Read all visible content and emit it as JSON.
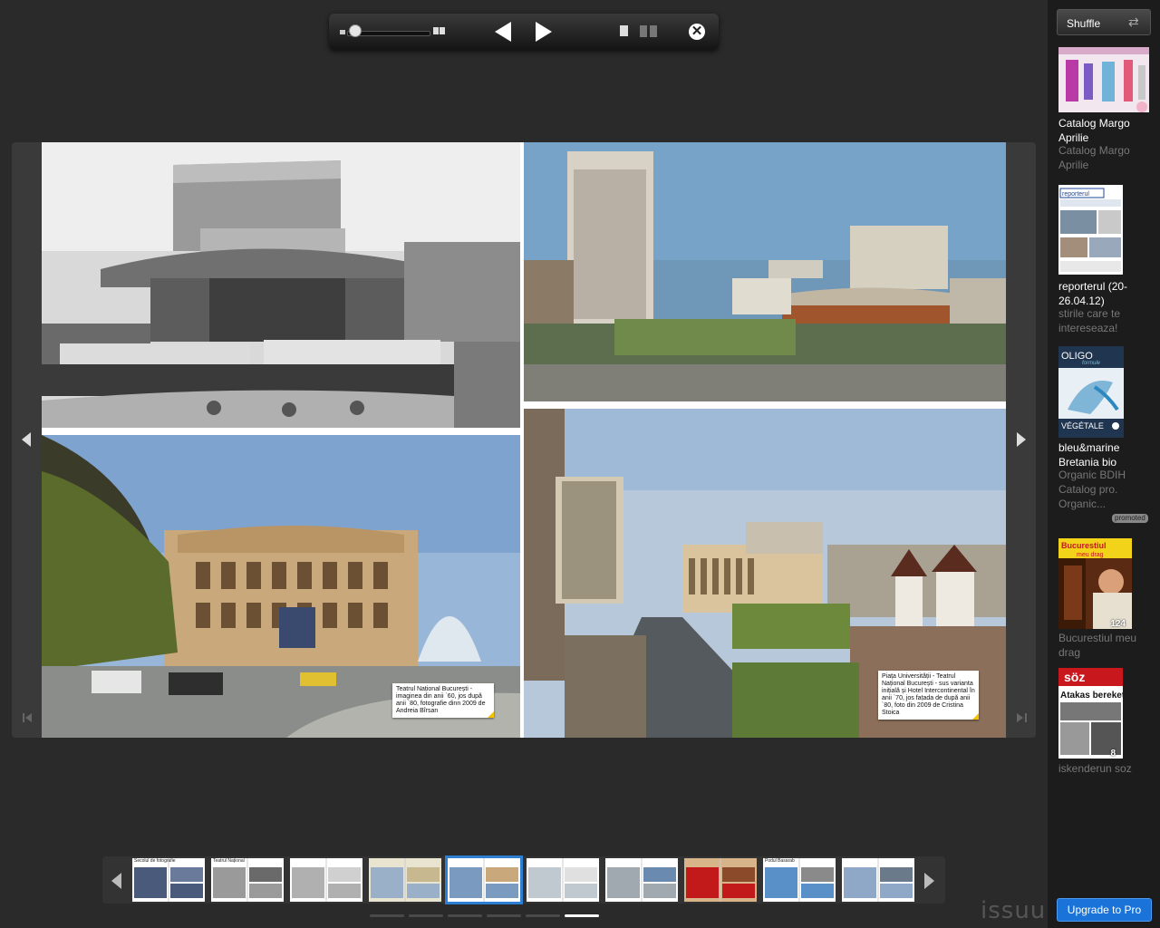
{
  "toolbar": {
    "icons": [
      "zoom-slider",
      "zoom-in-icon",
      "previous-page-icon",
      "next-page-icon",
      "single-page-view-icon",
      "double-page-view-icon",
      "close-icon"
    ],
    "zoom_level": 0.05
  },
  "spread": {
    "captions": {
      "left": "Teatrul Național București - imaginea din anii `60, jos după anii `80, fotografie dinn 2009 de Andreia Bîrsan",
      "right": "Piața Universității - Teatrul Național București - sus varianta inițială și Hotel Intercontinental în anii `70, jos fațada de după anii `80, foto din 2009 de Cristina Stoica"
    }
  },
  "thumbnails": {
    "pages": [
      "Secolul de fotografie",
      "Teatrul Național",
      "",
      "",
      "",
      "",
      "",
      "",
      "Podul Basarab",
      ""
    ],
    "active_index": 4,
    "pager_count": 6,
    "pager_active": 5
  },
  "brand": "issuu",
  "sidebar": {
    "shuffle_label": "Shuffle",
    "docs": [
      {
        "title": "Catalog Margo Aprilie",
        "desc": "Catalog Margo Aprilie",
        "count": ""
      },
      {
        "title": "reporterul (20-26.04.12)",
        "desc": "stirile care te intereseaza!",
        "count": ""
      },
      {
        "title": "bleu&marine Bretania bio",
        "desc": "Organic BDIH Catalog  pro. Organic...",
        "count": "",
        "cover_text": [
          "OLIGO",
          "formule",
          "VÉGÉTALE"
        ]
      },
      {
        "title": "",
        "desc": "Bucurestiul meu drag",
        "count": "124",
        "cover_text": [
          "Bucurestiul",
          "meu drag"
        ]
      },
      {
        "title": "",
        "desc": "iskenderun soz",
        "count": "8",
        "cover_text": [
          "söz",
          "Atakas bereketi!"
        ]
      }
    ],
    "promoted_label": "promoted",
    "upgrade_label": "Upgrade to Pro",
    "reporter_masthead": "reporterul"
  },
  "colors": {
    "background": "#2a2a2a",
    "sidebar": "#1c1c1c",
    "accent": "#1a73d9",
    "active_thumb": "#2d7fd3"
  }
}
